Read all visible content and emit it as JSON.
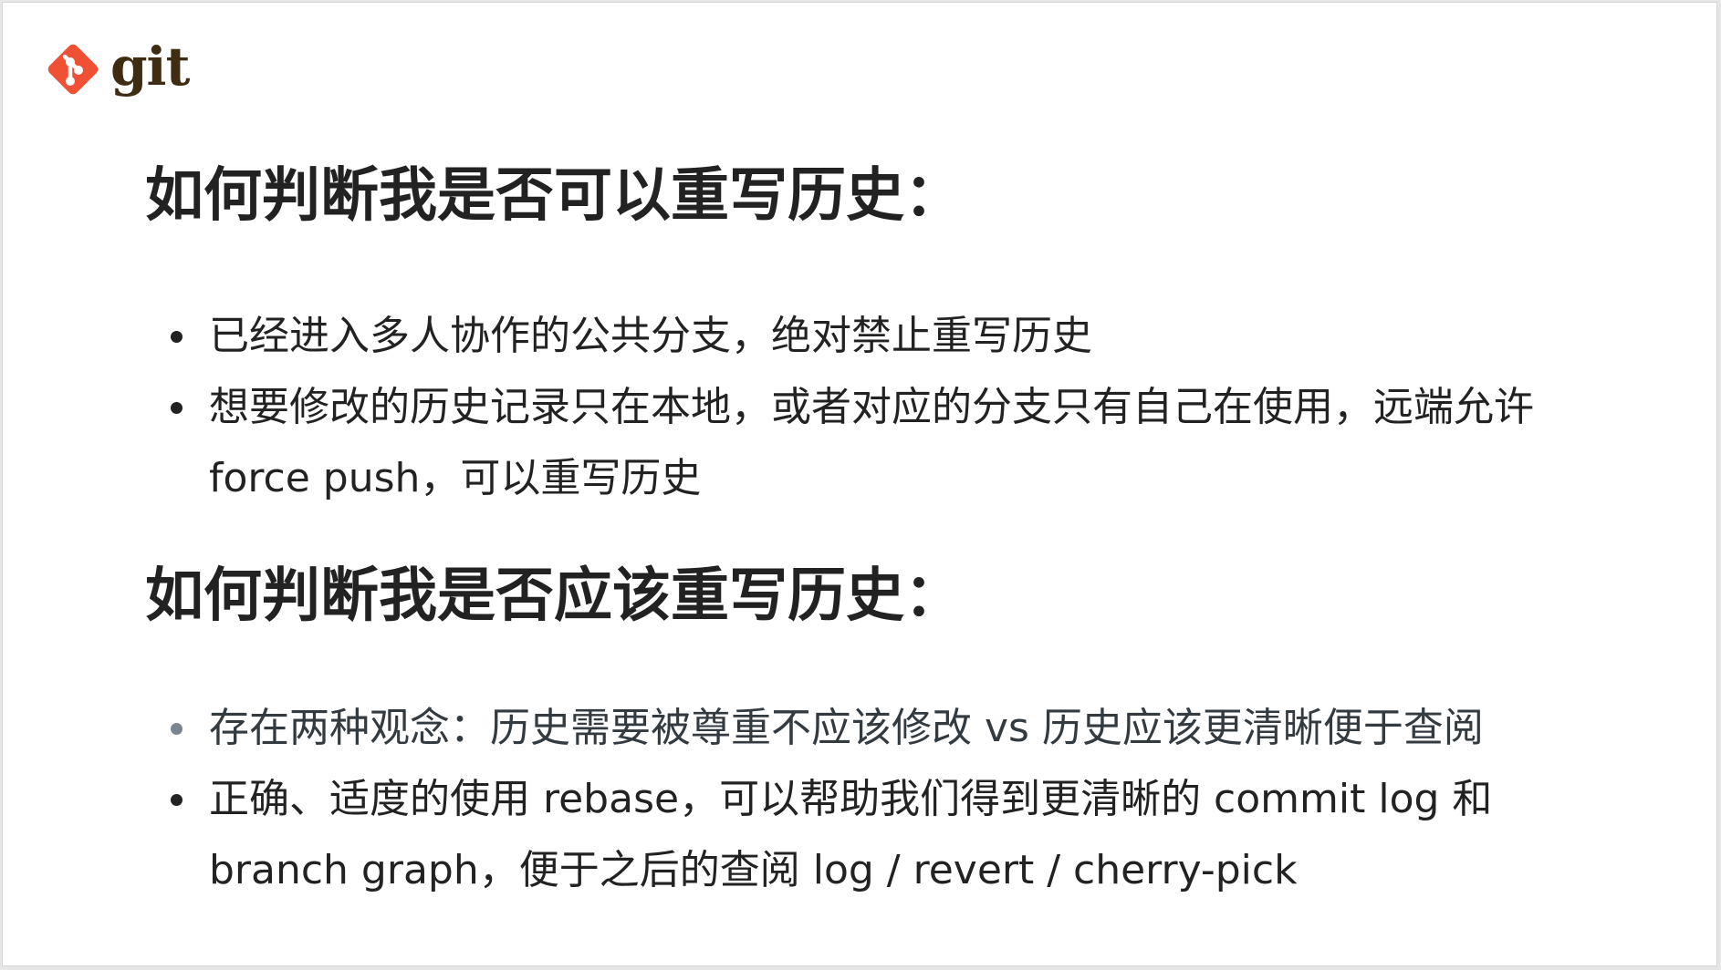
{
  "logo": {
    "text": "git",
    "icon": "git-logo-icon",
    "color": "#f05033"
  },
  "sections": [
    {
      "heading": "如何判断我是否可以重写历史：",
      "items": [
        {
          "text": "已经进入多人协作的公共分支，绝对禁止重写历史",
          "bullet_color": "#222222"
        },
        {
          "text": "想要修改的历史记录只在本地，或者对应的分支只有自己在使用，远端允许 force push，可以重写历史",
          "bullet_color": "#222222"
        }
      ]
    },
    {
      "heading": "如何判断我是否应该重写历史：",
      "items": [
        {
          "text": "存在两种观念：历史需要被尊重不应该修改 vs 历史应该更清晰便于查阅",
          "bullet_color": "#7b8591"
        },
        {
          "text": "正确、适度的使用 rebase，可以帮助我们得到更清晰的 commit log 和 branch graph，便于之后的查阅 log / revert / cherry-pick",
          "bullet_color": "#222222"
        }
      ]
    }
  ]
}
